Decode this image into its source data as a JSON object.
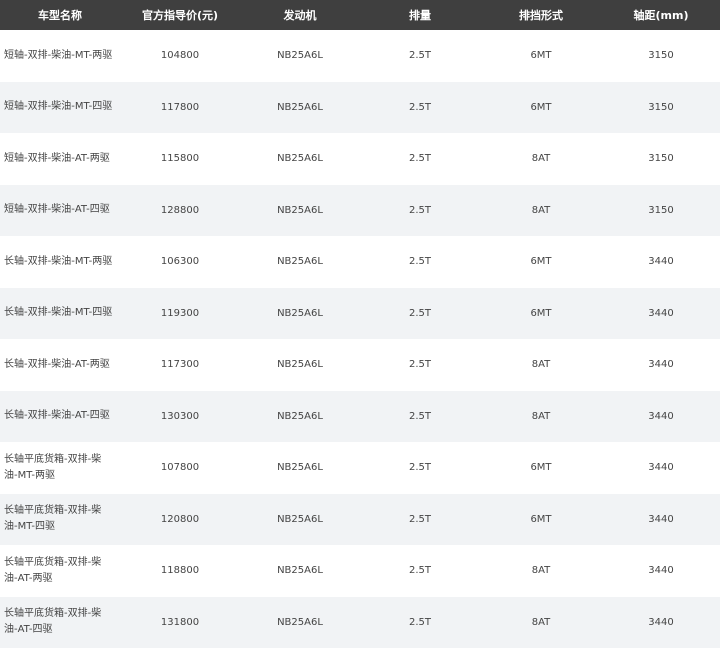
{
  "table": {
    "headers": {
      "model": "车型名称",
      "price": "官方指导价(元)",
      "engine": "发动机",
      "displacement": "排量",
      "transmission": "排挡形式",
      "wheelbase": "轴距(mm)"
    },
    "rows": [
      {
        "model": "短轴-双排-柴油-MT-两驱",
        "price": "104800",
        "engine": "NB25A6L",
        "displacement": "2.5T",
        "transmission": "6MT",
        "wheelbase": "3150"
      },
      {
        "model": "短轴-双排-柴油-MT-四驱",
        "price": "117800",
        "engine": "NB25A6L",
        "displacement": "2.5T",
        "transmission": "6MT",
        "wheelbase": "3150"
      },
      {
        "model": "短轴-双排-柴油-AT-两驱",
        "price": "115800",
        "engine": "NB25A6L",
        "displacement": "2.5T",
        "transmission": "8AT",
        "wheelbase": "3150"
      },
      {
        "model": "短轴-双排-柴油-AT-四驱",
        "price": "128800",
        "engine": "NB25A6L",
        "displacement": "2.5T",
        "transmission": "8AT",
        "wheelbase": "3150"
      },
      {
        "model": "长轴-双排-柴油-MT-两驱",
        "price": "106300",
        "engine": "NB25A6L",
        "displacement": "2.5T",
        "transmission": "6MT",
        "wheelbase": "3440"
      },
      {
        "model": "长轴-双排-柴油-MT-四驱",
        "price": "119300",
        "engine": "NB25A6L",
        "displacement": "2.5T",
        "transmission": "6MT",
        "wheelbase": "3440"
      },
      {
        "model": "长轴-双排-柴油-AT-两驱",
        "price": "117300",
        "engine": "NB25A6L",
        "displacement": "2.5T",
        "transmission": "8AT",
        "wheelbase": "3440"
      },
      {
        "model": "长轴-双排-柴油-AT-四驱",
        "price": "130300",
        "engine": "NB25A6L",
        "displacement": "2.5T",
        "transmission": "8AT",
        "wheelbase": "3440"
      },
      {
        "model": "长轴平底货箱-双排-柴油-MT-两驱",
        "price": "107800",
        "engine": "NB25A6L",
        "displacement": "2.5T",
        "transmission": "6MT",
        "wheelbase": "3440"
      },
      {
        "model": "长轴平底货箱-双排-柴油-MT-四驱",
        "price": "120800",
        "engine": "NB25A6L",
        "displacement": "2.5T",
        "transmission": "6MT",
        "wheelbase": "3440"
      },
      {
        "model": "长轴平底货箱-双排-柴油-AT-两驱",
        "price": "118800",
        "engine": "NB25A6L",
        "displacement": "2.5T",
        "transmission": "8AT",
        "wheelbase": "3440"
      },
      {
        "model": "长轴平底货箱-双排-柴油-AT-四驱",
        "price": "131800",
        "engine": "NB25A6L",
        "displacement": "2.5T",
        "transmission": "8AT",
        "wheelbase": "3440"
      }
    ]
  }
}
